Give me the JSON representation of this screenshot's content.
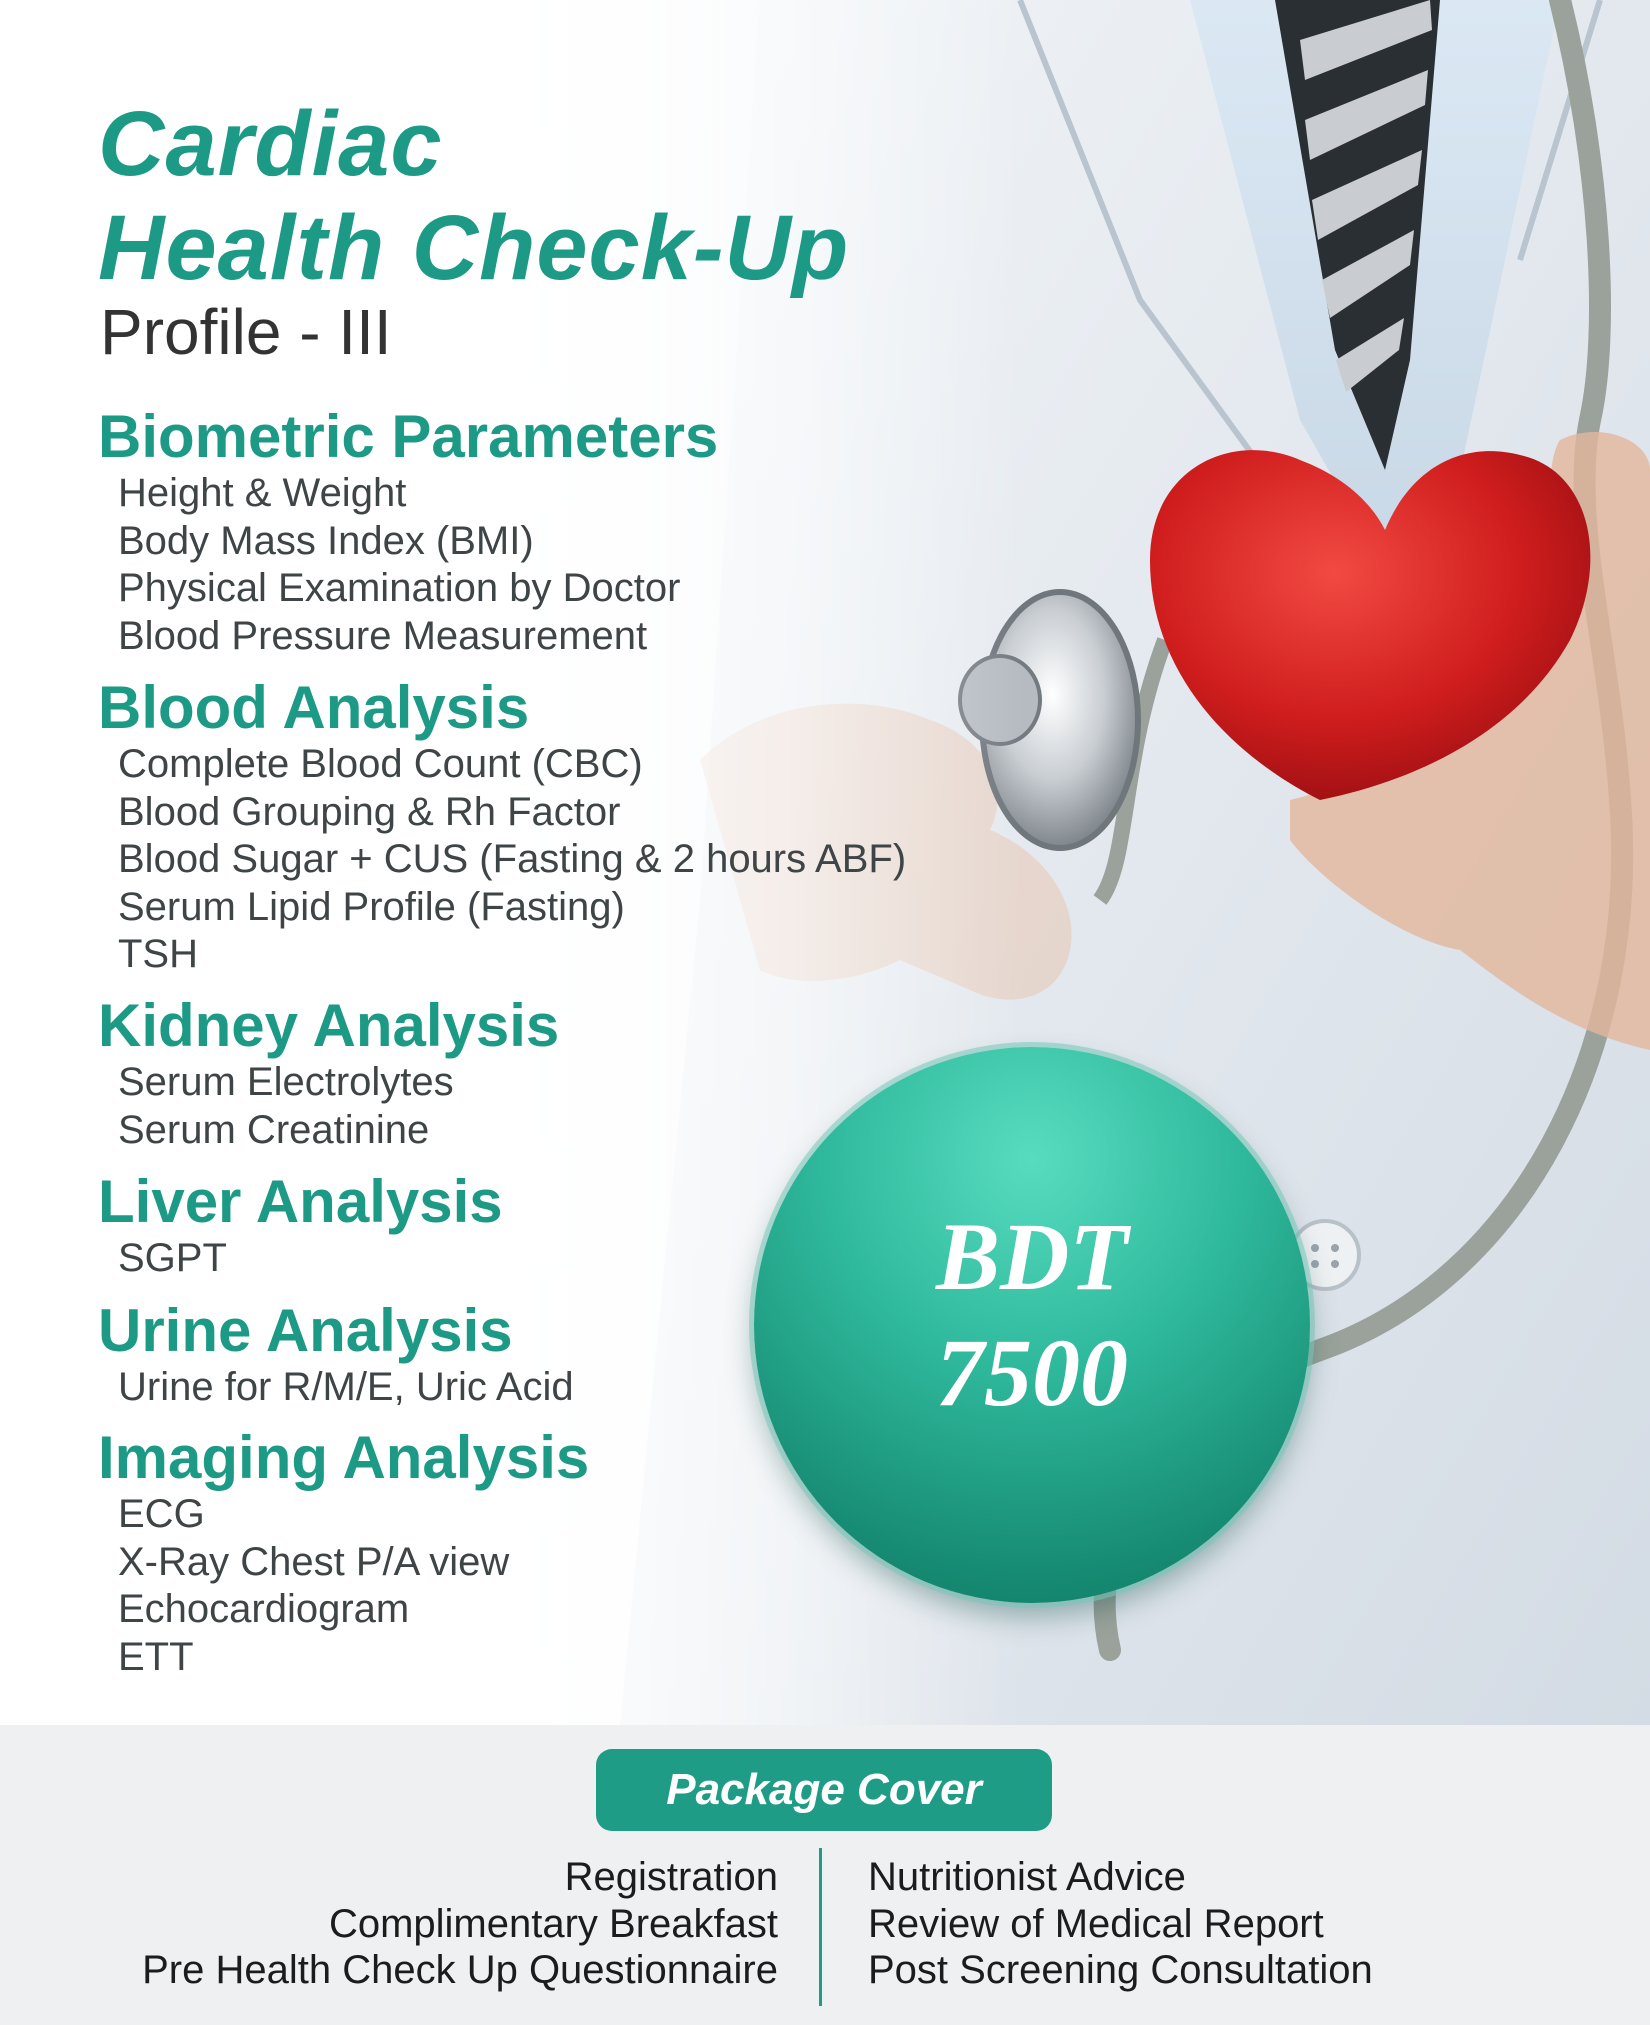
{
  "colors": {
    "accent": "#1d9a86",
    "price_badge": "#2fb99c",
    "text_dark": "#333333",
    "footer_bg": "#eef0f2"
  },
  "header": {
    "title_line1": "Cardiac",
    "title_line2": "Health Check-Up",
    "subtitle": "Profile - III"
  },
  "sections": [
    {
      "heading": "Biometric Parameters",
      "items": [
        "Height & Weight",
        "Body Mass Index (BMI)",
        "Physical Examination by Doctor",
        "Blood Pressure Measurement"
      ]
    },
    {
      "heading": "Blood Analysis",
      "items": [
        "Complete Blood Count (CBC)",
        "Blood Grouping & Rh Factor",
        "Blood Sugar + CUS (Fasting & 2 hours ABF)",
        "Serum Lipid Profile (Fasting)",
        "TSH"
      ]
    },
    {
      "heading": "Kidney Analysis",
      "items": [
        "Serum Electrolytes",
        "Serum Creatinine"
      ]
    },
    {
      "heading": "Liver Analysis",
      "items": [
        "SGPT"
      ]
    },
    {
      "heading": "Urine Analysis",
      "items": [
        "Urine for R/M/E, Uric Acid"
      ]
    },
    {
      "heading": "Imaging Analysis",
      "items": [
        "ECG",
        "X-Ray Chest P/A view",
        "Echocardiogram",
        "ETT"
      ]
    }
  ],
  "price": {
    "currency": "BDT",
    "amount": "7500"
  },
  "package_cover": {
    "label": "Package Cover",
    "left_items": [
      "Registration",
      "Complimentary Breakfast",
      "Pre Health Check Up Questionnaire"
    ],
    "right_items": [
      "Nutritionist Advice",
      "Review of Medical Report",
      "Post Screening Consultation"
    ]
  },
  "background": {
    "image_icons": [
      "doctor-coat-image",
      "necktie-image",
      "stethoscope-image",
      "red-heart-image"
    ]
  }
}
